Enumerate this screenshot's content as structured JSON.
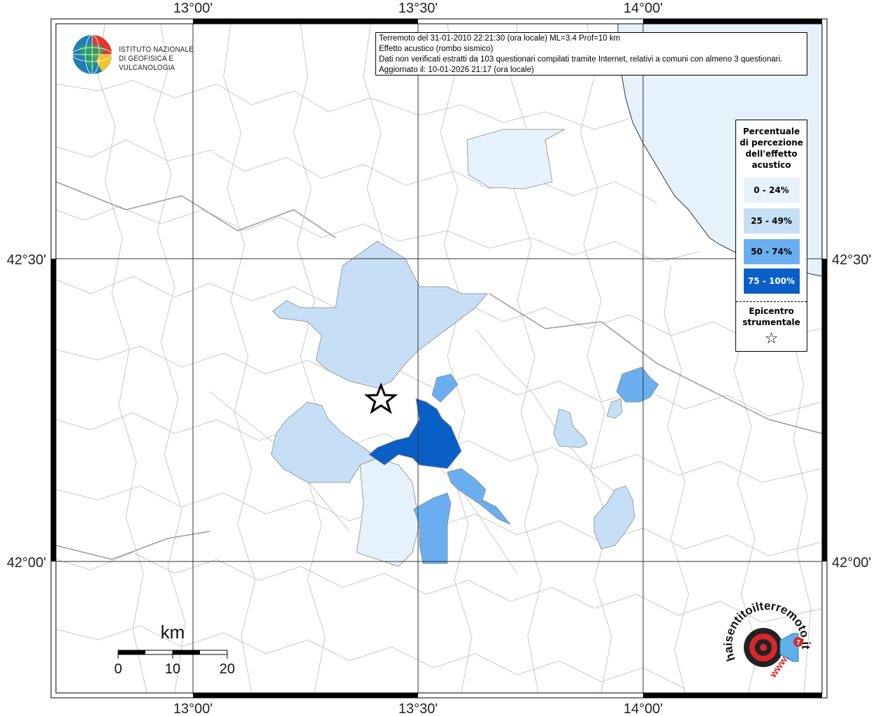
{
  "institute": {
    "name_line1": "ISTITUTO NAZIONALE",
    "name_line2": "DI GEOFISICA E VULCANOLOGIA",
    "logo_icon": "ingv-globe-logo-icon"
  },
  "info": {
    "line1": "Terremoto del 31-01-2010 22:21:30 (ora locale) ML=3.4 Prof=10 km",
    "line2": "Effetto acustico (rombo sismico)",
    "line3": "Dati non verificati estratti da 103 questionari compilati tramite Internet, relativi a comuni con almeno 3 questionari.",
    "line4": "Aggiornato il: 10-01-2026 21:17 (ora locale)"
  },
  "coordinates": {
    "lon_ticks": [
      "13°00'",
      "13°30'",
      "14°00'"
    ],
    "lat_ticks": [
      "42°30'",
      "42°00'"
    ]
  },
  "legend": {
    "title_line1": "Percentuale",
    "title_line2": "di percezione",
    "title_line3": "dell'effetto",
    "title_line4": "acustico",
    "classes": [
      {
        "label": "0 - 24%",
        "color": "#e6f2fb",
        "text_color": "#000000"
      },
      {
        "label": "25 - 49%",
        "color": "#c6dff6",
        "text_color": "#000000"
      },
      {
        "label": "50 - 74%",
        "color": "#6aaef0",
        "text_color": "#000000"
      },
      {
        "label": "75 - 100%",
        "color": "#0a5fc6",
        "text_color": "#ffffff"
      }
    ],
    "epicenter_line1": "Epicentro",
    "epicenter_line2": "strumentale",
    "epicenter_icon": "star-outline-icon"
  },
  "scale_bar": {
    "unit": "km",
    "ticks": [
      "0",
      "10",
      "20"
    ]
  },
  "colors": {
    "sea": "#e6f2fb",
    "border": "#c8c8c8",
    "grid": "#333333"
  },
  "badge": {
    "text": "haisentitoilterremoto.it",
    "prefix": "www.",
    "icon": "target-speaker-icon"
  }
}
